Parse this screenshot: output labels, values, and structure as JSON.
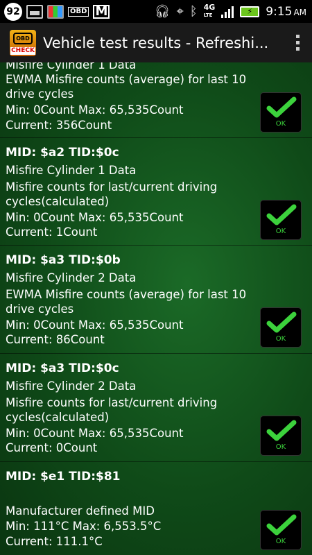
{
  "status_bar": {
    "notification_count": "92",
    "obd_label": "OBD",
    "network": "4G",
    "network_sub": "LTE",
    "time": "9:15",
    "ampm": "AM",
    "icons": [
      "gallery-icon",
      "apps-icon",
      "obd-icon",
      "gmail-icon",
      "headphones-icon",
      "gps-icon",
      "bluetooth-icon",
      "signal-icon",
      "battery-icon"
    ]
  },
  "action_bar": {
    "title": "Vehicle test results - Refreshi...",
    "app_icon_text": "OBD",
    "app_icon_sub": "CHECK"
  },
  "results": [
    {
      "header": "",
      "name": "Misfire Cylinder 1 Data",
      "description": [
        "EWMA Misfire counts (average) for last 10",
        "drive cycles"
      ],
      "range": "Min: 0Count  Max: 65,535Count",
      "current": "Current: 356Count",
      "status": "OK"
    },
    {
      "header": "MID: $a2 TID:$0c",
      "name": "Misfire Cylinder 1 Data",
      "description": [
        "Misfire counts for last/current driving",
        "cycles(calculated)"
      ],
      "range": "Min: 0Count  Max: 65,535Count",
      "current": "Current: 1Count",
      "status": "OK"
    },
    {
      "header": "MID: $a3 TID:$0b",
      "name": "Misfire Cylinder 2 Data",
      "description": [
        "EWMA Misfire counts (average) for last 10",
        "drive cycles"
      ],
      "range": "Min: 0Count  Max: 65,535Count",
      "current": "Current: 86Count",
      "status": "OK"
    },
    {
      "header": "MID: $a3 TID:$0c",
      "name": "Misfire Cylinder 2 Data",
      "description": [
        "Misfire counts for last/current driving",
        "cycles(calculated)"
      ],
      "range": "Min: 0Count  Max: 65,535Count",
      "current": "Current: 0Count",
      "status": "OK"
    },
    {
      "header": "MID: $e1 TID:$81",
      "name": "",
      "description": [
        "Manufacturer defined MID"
      ],
      "range": "Min: 111°C  Max: 6,553.5°C",
      "current": "Current: 111.1°C",
      "status": "OK"
    }
  ],
  "colors": {
    "background": "#0f4a18",
    "ok_check": "#3cd23c",
    "status_bar": "#000000",
    "action_bar": "#1a1a1a"
  }
}
